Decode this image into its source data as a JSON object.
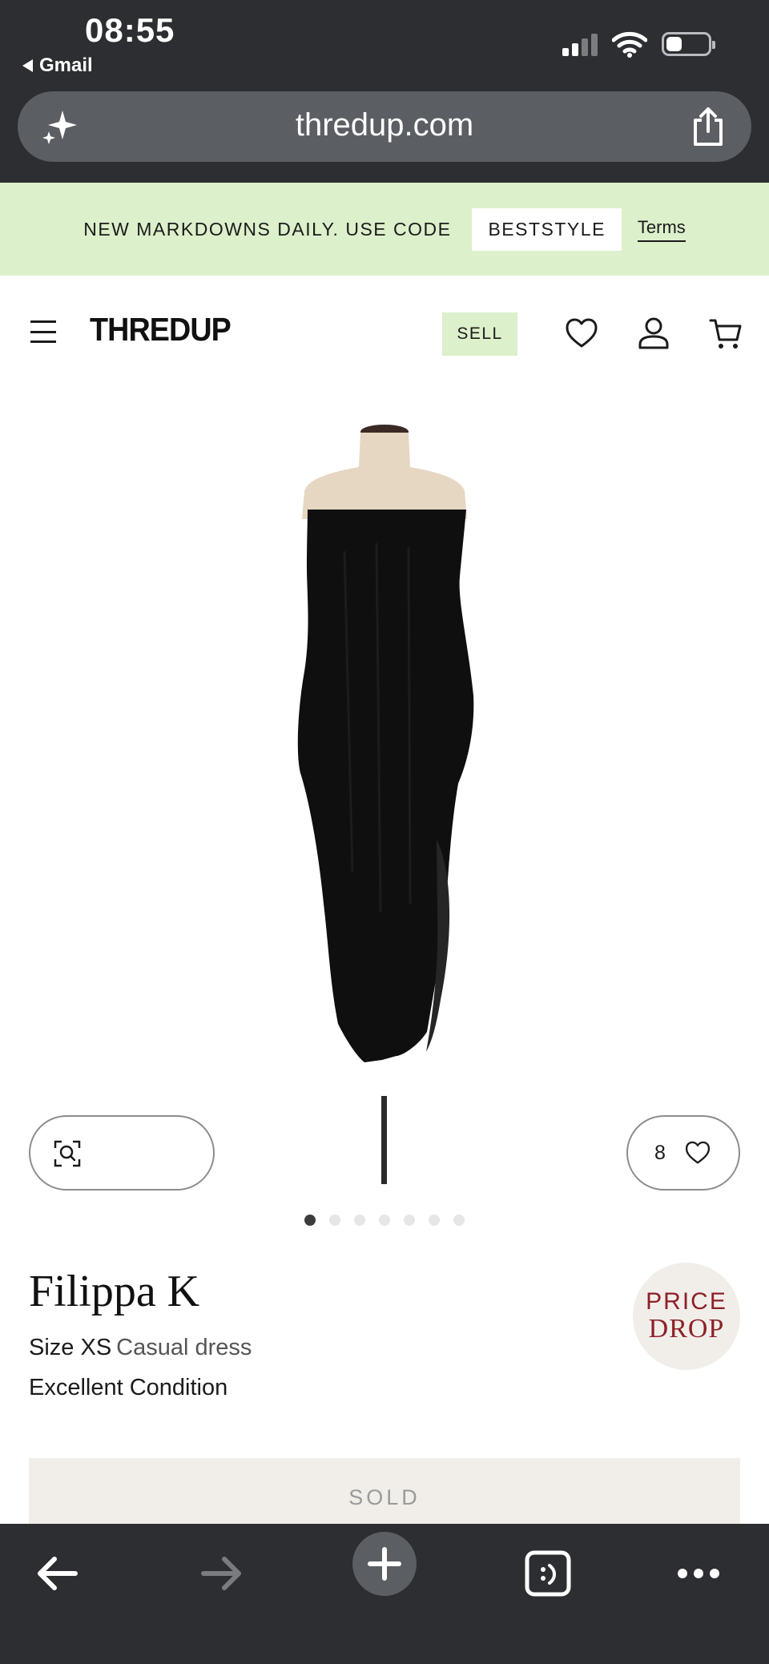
{
  "status_bar": {
    "time": "08:55",
    "back_app": "Gmail"
  },
  "browser": {
    "url": "thredup.com"
  },
  "promo": {
    "text": "NEW MARKDOWNS DAILY. USE CODE",
    "code": "BESTSTYLE",
    "terms": "Terms",
    "background_color": "#dcf0cb"
  },
  "header": {
    "logo": "THREDUP",
    "sell_label": "SELL",
    "icons": [
      "menu-icon",
      "heart-icon",
      "account-icon",
      "cart-icon"
    ]
  },
  "product": {
    "favorites_count": "8",
    "image_count": 7,
    "active_image": 1,
    "brand": "Filippa K",
    "size": "Size XS",
    "category": "Casual dress",
    "condition": "Excellent Condition",
    "badge_line1": "PRICE",
    "badge_line2": "DROP",
    "badge_color": "#8e2027",
    "status_label": "SOLD"
  },
  "toolbar": {
    "icons": [
      "back-arrow-icon",
      "forward-arrow-icon",
      "new-tab-plus-icon",
      "tabs-icon",
      "more-icon"
    ]
  }
}
